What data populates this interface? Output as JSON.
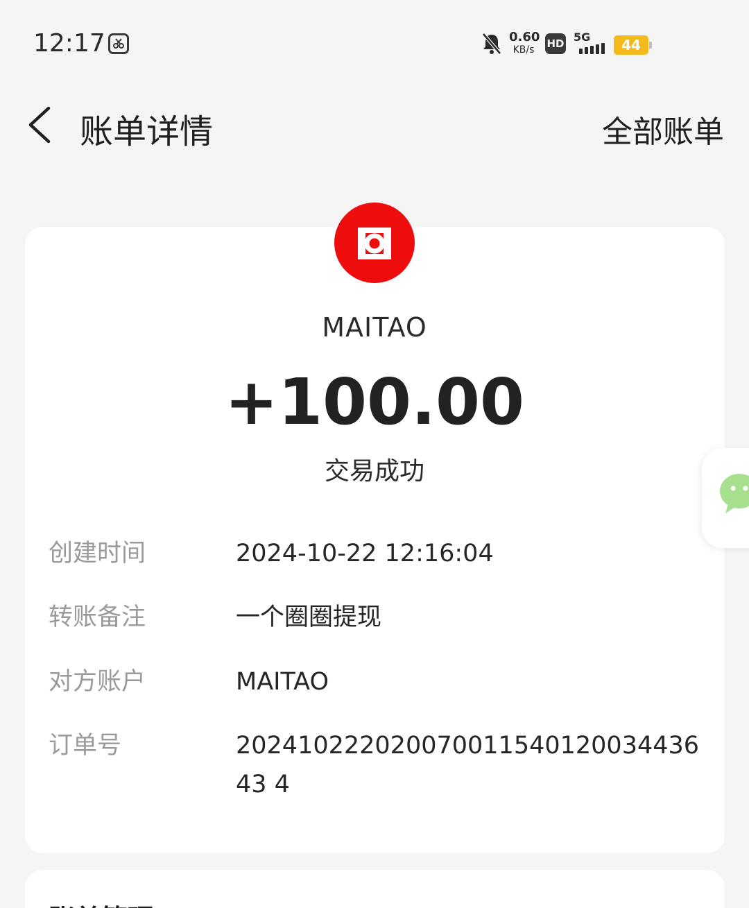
{
  "status_bar": {
    "time": "12:17",
    "net_speed_value": "0.60",
    "net_speed_unit": "KB/s",
    "hd_label": "HD",
    "network_type": "5G",
    "battery_level": "44",
    "battery_color": "#f4b91a"
  },
  "header": {
    "title": "账单详情",
    "all_bills_label": "全部账单"
  },
  "merchant": {
    "name": "MAITAO",
    "logo_color": "#ee0d0d"
  },
  "transaction": {
    "amount": "+100.00",
    "status": "交易成功"
  },
  "details": [
    {
      "label": "创建时间",
      "value": "2024-10-22 12:16:04"
    },
    {
      "label": "转账备注",
      "value": "一个圈圈提现"
    },
    {
      "label": "对方账户",
      "value": "MAITAO"
    },
    {
      "label": "订单号",
      "value": "20241022202007001154012003443643 4"
    }
  ],
  "manage_section": {
    "title": "账单管理"
  }
}
